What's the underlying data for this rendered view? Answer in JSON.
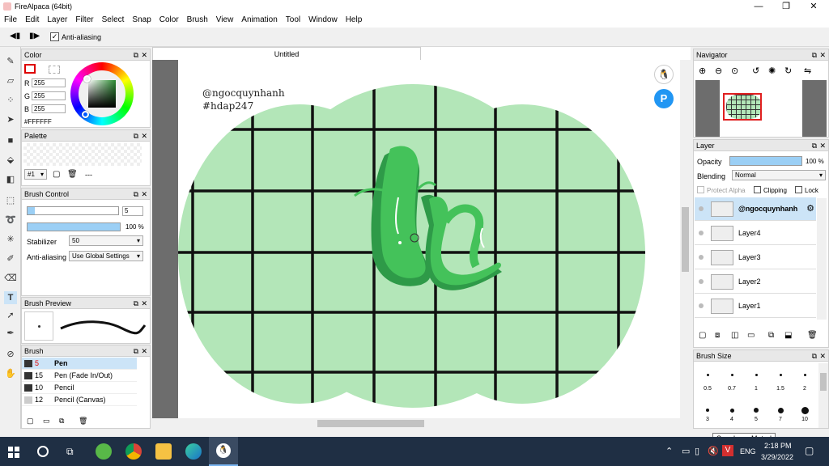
{
  "app": {
    "title": "FireAlpaca (64bit)",
    "minimize": "—",
    "restore": "❐",
    "close": "✕"
  },
  "menu": [
    "File",
    "Edit",
    "Layer",
    "Filter",
    "Select",
    "Snap",
    "Color",
    "Brush",
    "View",
    "Animation",
    "Tool",
    "Window",
    "Help"
  ],
  "tool_options": {
    "antialias_label": "Anti-aliasing",
    "antialias_checked": true
  },
  "color_panel": {
    "title": "Color",
    "r_label": "R",
    "g_label": "G",
    "b_label": "B",
    "r": "255",
    "g": "255",
    "b": "255",
    "hex": "#FFFFFF"
  },
  "palette_panel": {
    "title": "Palette",
    "index": "#1",
    "dash": "---"
  },
  "brush_control": {
    "title": "Brush Control",
    "size": "5",
    "opacity": "100 %",
    "stabilizer_label": "Stabilizer",
    "stabilizer": "50",
    "antialias_label": "Anti-aliasing",
    "antialias": "Use Global Settings"
  },
  "brush_preview": {
    "title": "Brush Preview"
  },
  "brush_panel": {
    "title": "Brush",
    "items": [
      {
        "size": "5",
        "name": "Pen",
        "color": "#333333"
      },
      {
        "size": "15",
        "name": "Pen (Fade In/Out)",
        "color": "#333333"
      },
      {
        "size": "10",
        "name": "Pencil",
        "color": "#333333"
      },
      {
        "size": "12",
        "name": "Pencil (Canvas)",
        "color": "#cccccc"
      }
    ]
  },
  "document": {
    "tab": "Untitled"
  },
  "canvas_text": {
    "line1": "@ngocquynhanh",
    "line2": "#hdap247"
  },
  "navigator": {
    "title": "Navigator"
  },
  "layer_panel": {
    "title": "Layer",
    "opacity_label": "Opacity",
    "opacity": "100 %",
    "blending_label": "Blending",
    "blending": "Normal",
    "protect_alpha": "Protect Alpha",
    "clipping": "Clipping",
    "lock": "Lock",
    "layers": [
      {
        "name": "@ngocquynhanh",
        "selected": true
      },
      {
        "name": "Layer4",
        "selected": false
      },
      {
        "name": "Layer3",
        "selected": false
      },
      {
        "name": "Layer2",
        "selected": false
      },
      {
        "name": "Layer1",
        "selected": false
      }
    ]
  },
  "brush_size": {
    "title": "Brush Size",
    "labels": [
      "0.5",
      "0.7",
      "1",
      "1.5",
      "2",
      "3",
      "4",
      "5",
      "7",
      "10"
    ]
  },
  "tooltip": "Speakers: Muted",
  "tray": {
    "lang": "ENG",
    "time": "2:18 PM",
    "date": "3/29/2022"
  },
  "colors": {
    "canvas_green": "#b3e6b8",
    "grid": "#111111",
    "accent": "#4aa8e8",
    "drawing_green": "#44c25a"
  }
}
